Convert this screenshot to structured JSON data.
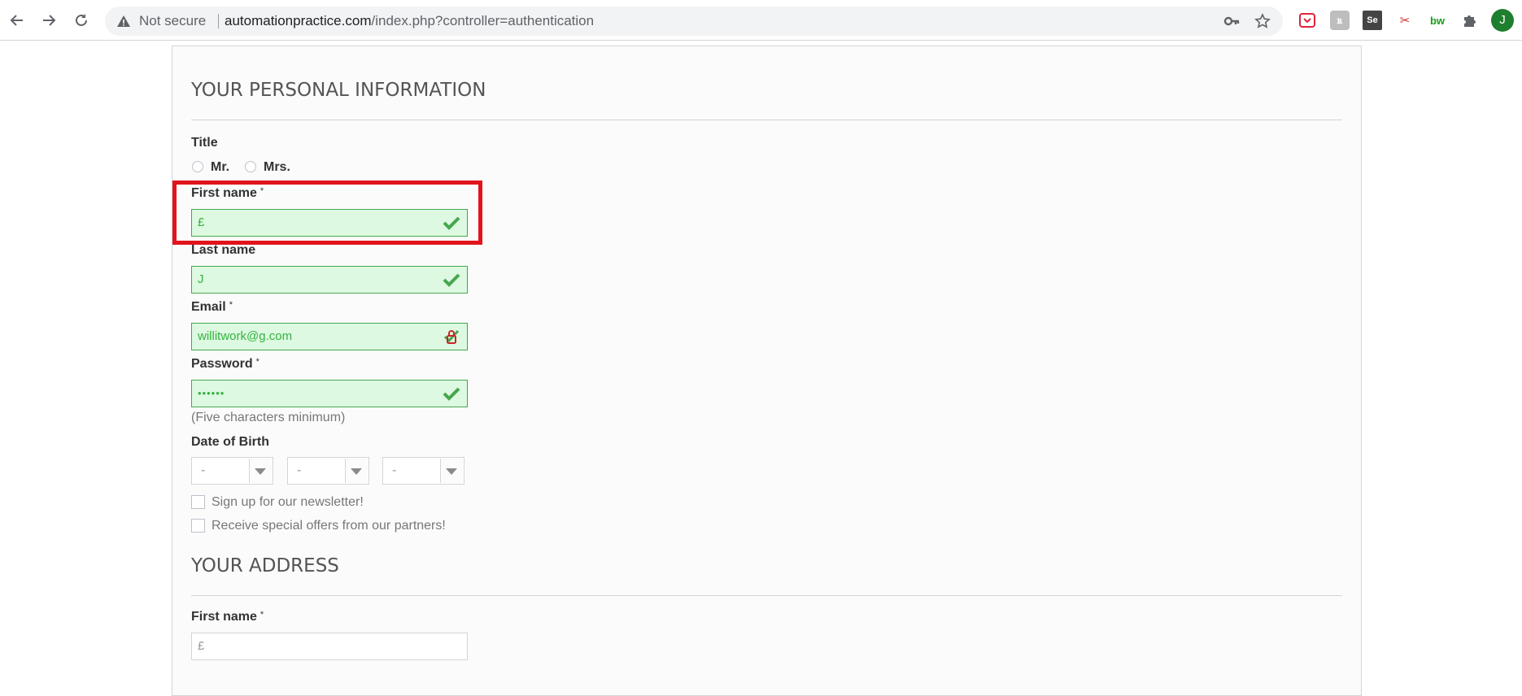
{
  "browser": {
    "security_label": "Not secure",
    "url_host": "automationpractice.com",
    "url_path": "/index.php?controller=authentication",
    "icons": [
      "back-icon",
      "forward-icon",
      "reload-icon",
      "warning-icon",
      "key-icon",
      "star-icon",
      "extension-puzzle-icon"
    ],
    "extensions": [
      {
        "name": "pocket-extension-icon",
        "text": "",
        "color": "#e0223d"
      },
      {
        "name": "grey-extension-icon",
        "text": "ꭱ",
        "color": "#9e9e9e"
      },
      {
        "name": "selenium-extension-icon",
        "text": "Se",
        "color": "#444444"
      },
      {
        "name": "red-tool-extension-icon",
        "text": "✂",
        "color": "#d32f2f"
      },
      {
        "name": "bw-extension-icon",
        "text": "bw",
        "color": "#1b9b1b"
      }
    ],
    "profile_initial": "J"
  },
  "personal": {
    "heading": "YOUR PERSONAL INFORMATION",
    "title_label": "Title",
    "title_options": [
      "Mr.",
      "Mrs."
    ],
    "first_name_label": "First name",
    "first_name_value": "£",
    "last_name_label": "Last name",
    "last_name_value": "J",
    "email_label": "Email",
    "email_value": "willitwork@g.com",
    "password_label": "Password",
    "password_value": "••••••",
    "required_mark": "*",
    "password_hint": "(Five characters minimum)",
    "dob_label": "Date of Birth",
    "dob_values": [
      "-",
      "-",
      "-"
    ],
    "newsletter_label": "Sign up for our newsletter!",
    "offers_label": "Receive special offers from our partners!"
  },
  "address": {
    "heading": "YOUR ADDRESS",
    "first_name_label": "First name",
    "first_name_placeholder": "£"
  },
  "colors": {
    "valid_border": "#46a74e",
    "valid_bg": "#ddf9e1",
    "highlight": "#e1141c"
  }
}
